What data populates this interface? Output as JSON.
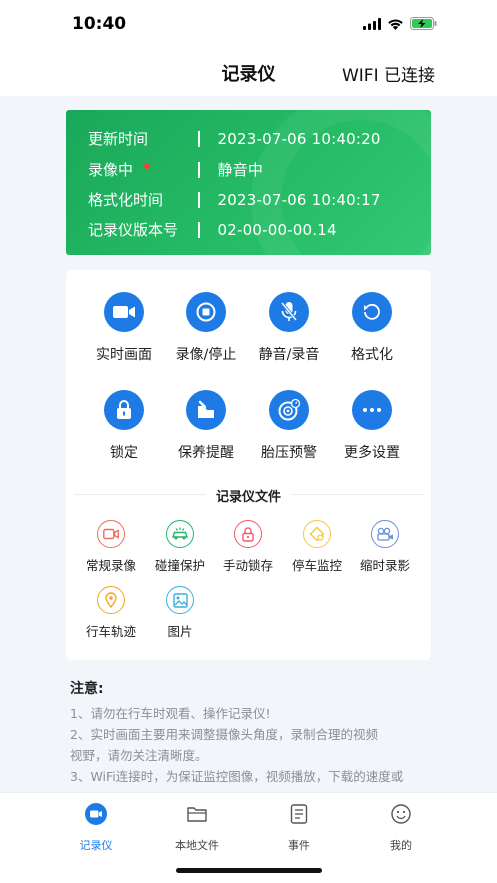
{
  "status": {
    "time": "10:40",
    "icons": [
      "signal-icon",
      "wifi-icon",
      "battery-charging-icon"
    ]
  },
  "nav": {
    "title": "记录仪",
    "connection": "WIFI 已连接"
  },
  "info": {
    "rows": [
      {
        "label": "更新时间",
        "value": "2023-07-06 10:40:20"
      },
      {
        "label": "录像中",
        "value": "静音中"
      },
      {
        "label": "格式化时间",
        "value": "2023-07-06 10:40:17"
      },
      {
        "label": "记录仪版本号",
        "value": "02-00-00-00.14"
      }
    ],
    "accent": "#1aa85a",
    "recording_dot_color": "#ff3b30"
  },
  "functions": [
    {
      "label": "实时画面",
      "icon": "camera-icon"
    },
    {
      "label": "录像/停止",
      "icon": "record-stop-icon"
    },
    {
      "label": "静音/录音",
      "icon": "mic-mute-icon"
    },
    {
      "label": "格式化",
      "icon": "reset-icon"
    },
    {
      "label": "锁定",
      "icon": "lock-icon"
    },
    {
      "label": "保养提醒",
      "icon": "maintenance-icon"
    },
    {
      "label": "胎压预警",
      "icon": "tire-pressure-icon"
    },
    {
      "label": "更多设置",
      "icon": "more-icon"
    }
  ],
  "files": {
    "title": "记录仪文件",
    "items": [
      {
        "label": "常规录像",
        "icon": "video-file-icon",
        "color": "#f06b57"
      },
      {
        "label": "碰撞保护",
        "icon": "collision-icon",
        "color": "#22b46b"
      },
      {
        "label": "手动锁存",
        "icon": "manual-lock-icon",
        "color": "#f2596b"
      },
      {
        "label": "停车监控",
        "icon": "parking-icon",
        "color": "#f5c744"
      },
      {
        "label": "缩时录影",
        "icon": "timelapse-icon",
        "color": "#6b8fd8"
      },
      {
        "label": "行车轨迹",
        "icon": "location-icon",
        "color": "#f5a623"
      },
      {
        "label": "图片",
        "icon": "image-icon",
        "color": "#3aaed8"
      }
    ]
  },
  "notes": {
    "title": "注意:",
    "lines": [
      "1、请勿在行车时观看、操作记录仪!",
      "2、实时画面主要用来调整摄像头角度，录制合理的视频",
      "视野，请勿关注清晰度。",
      "3、WiFi连接时，为保证监控图像，视频播放，下载的速度或"
    ]
  },
  "tabs": [
    {
      "label": "记录仪",
      "icon": "recorder-tab-icon",
      "active": true
    },
    {
      "label": "本地文件",
      "icon": "folder-icon",
      "active": false
    },
    {
      "label": "事件",
      "icon": "event-list-icon",
      "active": false
    },
    {
      "label": "我的",
      "icon": "profile-smile-icon",
      "active": false
    }
  ],
  "colors": {
    "primary": "#1e7be6",
    "background": "#f2f5f9"
  }
}
